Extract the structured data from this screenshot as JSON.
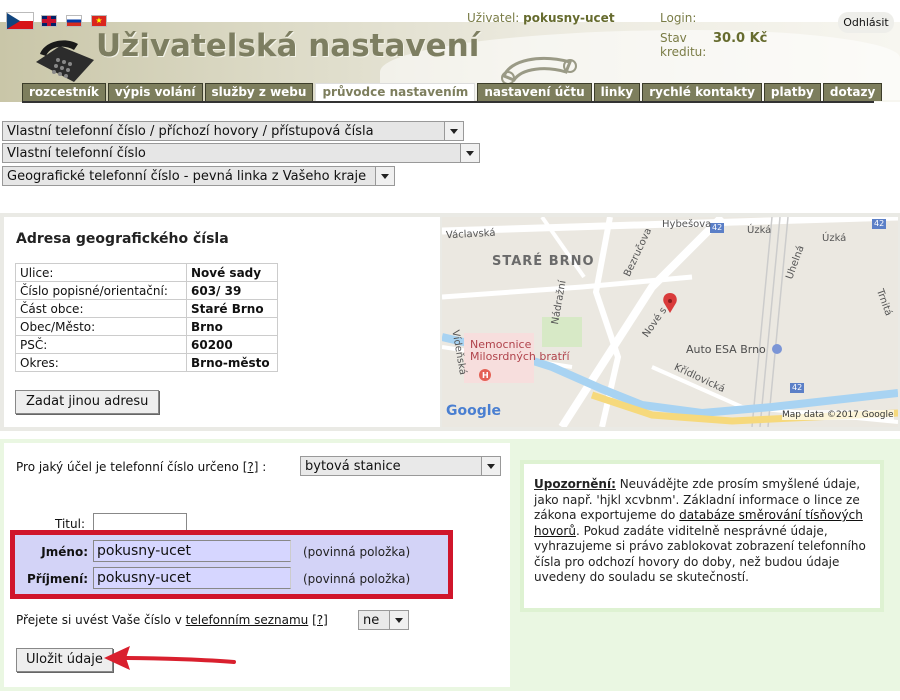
{
  "header": {
    "title": "Uživatelská nastavení",
    "user_label": "Uživatel:",
    "user_value": "pokusny-ucet",
    "login_label": "Login:",
    "credit_label": "Stav kreditu:",
    "credit_value": "30.0 Kč",
    "logout_label": "Odhlásit",
    "flags": [
      "flag-cz-icon",
      "flag-gb-icon",
      "flag-ru-icon",
      "flag-vn-icon"
    ]
  },
  "tabs": [
    {
      "label": "rozcestník",
      "active": false
    },
    {
      "label": "výpis volání",
      "active": false
    },
    {
      "label": "služby z webu",
      "active": false
    },
    {
      "label": "průvodce nastavením",
      "active": true
    },
    {
      "label": "nastavení účtu",
      "active": false
    },
    {
      "label": "linky",
      "active": false
    },
    {
      "label": "rychlé kontakty",
      "active": false
    },
    {
      "label": "platby",
      "active": false
    },
    {
      "label": "dotazy",
      "active": false
    }
  ],
  "wizard": {
    "select1": "Vlastní telefonní číslo / příchozí hovory / přístupová čísla",
    "select2": "Vlastní telefonní číslo",
    "select3": "Geografické telefonní číslo - pevná linka z Vašeho kraje"
  },
  "address": {
    "title": "Adresa geografického čísla",
    "rows": [
      {
        "key": "Ulice:",
        "value": "Nové sady"
      },
      {
        "key": "Číslo popisné/orientační:",
        "value": "603/ 39"
      },
      {
        "key": "Část obce:",
        "value": "Staré Brno"
      },
      {
        "key": "Obec/Město:",
        "value": "Brno"
      },
      {
        "key": "PSČ:",
        "value": "60200"
      },
      {
        "key": "Okres:",
        "value": "Brno-město"
      }
    ],
    "change_button": "Zadat jinou adresu"
  },
  "map": {
    "labels": {
      "area": "STARÉ BRNO",
      "vaclavska": "Václavská",
      "hybesova": "Hybešova",
      "uzka1": "Úzká",
      "uzka2": "Úzká",
      "bezrucova": "Bezručova",
      "nadrazni": "Nádražní",
      "nove_sady": "Nové s",
      "uhelna": "Uhelná",
      "trnita": "Trnitá",
      "videnska": "Vídeňská",
      "hospital": "Nemocnice Milosrdných bratří",
      "autoesa": "Auto ESA Brno",
      "kridlovicka": "Křídlovická",
      "road42a": "42",
      "road42b": "42",
      "road42c": "42",
      "google": "Google",
      "attribution": "Map data ©2017 Google"
    }
  },
  "form": {
    "purpose_label": "Pro jaký účel je telefonní číslo určeno",
    "help_marker": "[?]",
    "colon": ":",
    "purpose_value": "bytová stanice",
    "titul_label": "Titul:",
    "titul_value": "",
    "jmeno_label": "Jméno:",
    "jmeno_value": "pokusny-ucet",
    "prijmeni_label": "Příjmení:",
    "prijmeni_value": "pokusny-ucet",
    "required_note": "(povinná položka)",
    "directory_prefix": "Přejete si uvést Vaše číslo v",
    "directory_link": "telefonním seznamu",
    "directory_value": "ne",
    "save_button": "Uložit údaje"
  },
  "warning": {
    "title": "Upozornění:",
    "text1": " Neuvádějte zde prosím smyšlené údaje, jako např. 'hjkl xcvbnm'. Základní informace o lince ze zákona exportujeme do ",
    "link": "databáze směrování tísňových hovorů",
    "text2": ". Pokud zadáte viditelně nesprávné údaje, vyhrazujeme si právo zablokovat zobrazení telefonního čísla pro odchozí hovory do doby, než budou údaje uvedeny do souladu se skutečností."
  },
  "colors": {
    "tab_bg": "#7d7e5d",
    "highlight_border": "#d0152b",
    "input_bg": "#d6d6ff",
    "form_panel_bg": "#eaf7e2"
  }
}
